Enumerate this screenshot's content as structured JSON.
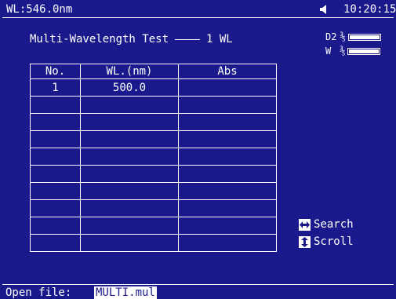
{
  "status": {
    "wavelength": "WL:546.0nm",
    "time": "10:20:15"
  },
  "test": {
    "title": "Multi-Wavelength Test",
    "mode": "1 WL"
  },
  "lamps": [
    {
      "label": "D2",
      "state": "on"
    },
    {
      "label": "W",
      "state": "on"
    }
  ],
  "table": {
    "headers": [
      "No.",
      "WL.(nm)",
      "Abs"
    ],
    "rows": [
      [
        "1",
        "500.0",
        ""
      ],
      [
        "",
        "",
        ""
      ],
      [
        "",
        "",
        ""
      ],
      [
        "",
        "",
        ""
      ],
      [
        "",
        "",
        ""
      ],
      [
        "",
        "",
        ""
      ],
      [
        "",
        "",
        ""
      ],
      [
        "",
        "",
        ""
      ],
      [
        "",
        "",
        ""
      ],
      [
        "",
        "",
        ""
      ]
    ]
  },
  "legend": {
    "search": "Search",
    "scroll": "Scroll"
  },
  "footer": {
    "label": "Open file:",
    "file": "MULTI.mul"
  },
  "colors": {
    "background": "#1a1a8c",
    "foreground": "#ffffff"
  },
  "icons": {
    "speaker": "speaker-icon",
    "search": "left-right-arrow-icon",
    "scroll": "up-down-arrow-icon"
  }
}
